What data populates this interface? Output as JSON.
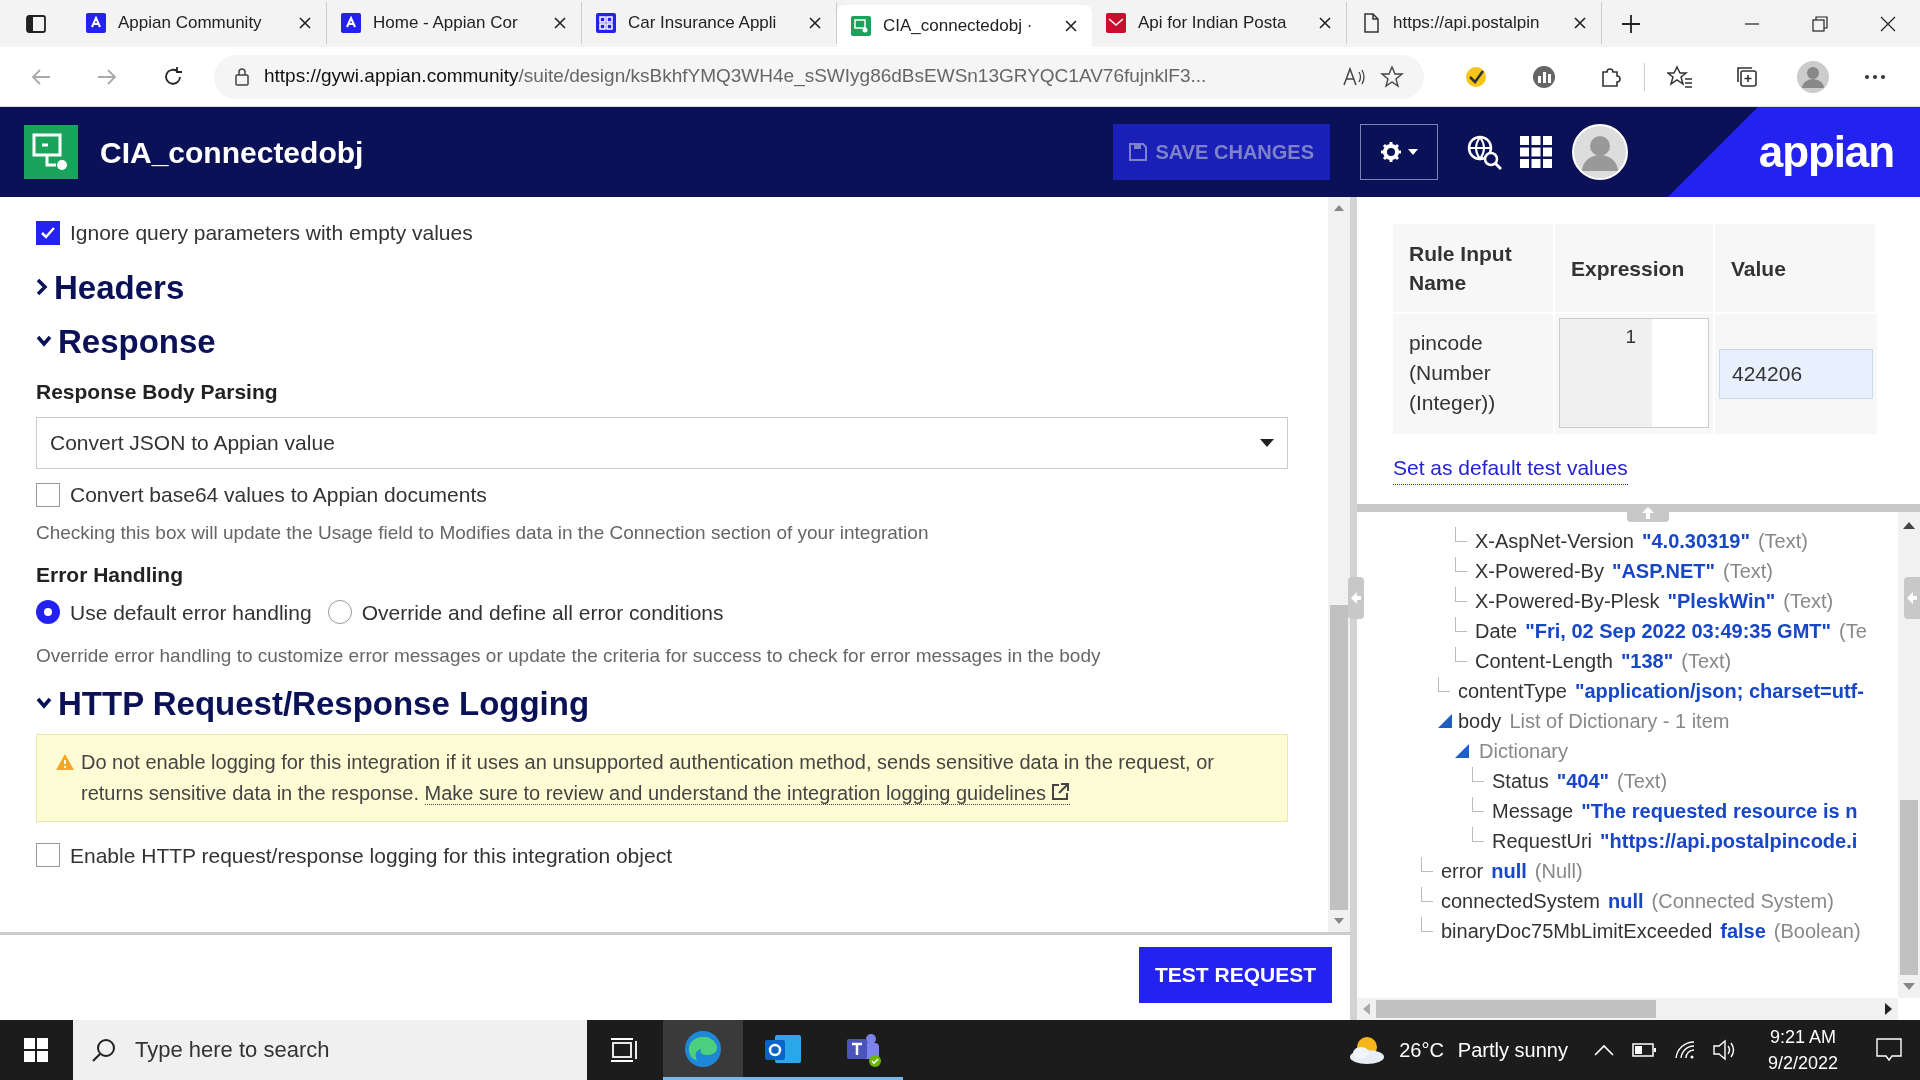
{
  "browser": {
    "tabs": [
      {
        "label": "Appian Community",
        "selected": false
      },
      {
        "label": "Home - Appian Cor",
        "selected": false
      },
      {
        "label": "Car Insurance Appli",
        "selected": false
      },
      {
        "label": "CIA_connectedobj ·",
        "selected": true
      },
      {
        "label": "Api for Indian Posta",
        "selected": false
      },
      {
        "label": "https://api.postalpin",
        "selected": false
      }
    ],
    "url_host": "https://gywi.appian.community",
    "url_path": "/suite/design/ksBkhfYMQ3WH4e_sSWIyg86dBsEWSn13GRYQC1AV76fujnklF3..."
  },
  "header": {
    "title": "CIA_connectedobj",
    "save_button": {
      "label": "SAVE CHANGES",
      "disabled": true
    },
    "brand": "appian"
  },
  "form": {
    "ignore_empty": {
      "label": "Ignore query parameters with empty values",
      "checked": true
    },
    "sections": [
      {
        "title": "Headers",
        "expanded": false
      },
      {
        "title": "Response",
        "expanded": true
      }
    ],
    "parsing_label": "Response Body Parsing",
    "parsing_value": "Convert JSON to Appian value",
    "base64": {
      "label": "Convert base64 values to Appian documents",
      "checked": false
    },
    "base64_help": "Checking this box will update the Usage field to Modifies data in the Connection section of your integration",
    "error_label": "Error Handling",
    "error_options": [
      {
        "label": "Use default error handling",
        "selected": true
      },
      {
        "label": "Override and define all error conditions",
        "selected": false
      }
    ],
    "error_help": "Override error handling to customize error messages or update the criteria for success to check for error messages in the body",
    "logging_section": {
      "title": "HTTP Request/Response Logging",
      "expanded": true
    },
    "warning": "Do not enable logging for this integration if it uses an unsupported authentication method, sends sensitive data in the request, or returns sensitive data in the response.",
    "warning_link": "Make sure to review and understand the integration logging guidelines",
    "logging": {
      "label": "Enable HTTP request/response logging for this integration object",
      "checked": false
    },
    "test_button": "TEST REQUEST"
  },
  "test_inputs": {
    "columns": [
      "Rule Input Name",
      "Expression",
      "Value"
    ],
    "rows": [
      {
        "name": "pincode (Number (Integer))",
        "line_number": "1",
        "value": "424206"
      }
    ],
    "default_link": "Set as default test values"
  },
  "result_tree": [
    {
      "children": [
        {
          "children": [
            {
              "key": "X-AspNet-Version",
              "value": "\"4.0.30319\"",
              "type": "(Text)"
            },
            {
              "key": "X-Powered-By",
              "value": "\"ASP.NET\"",
              "type": "(Text)"
            },
            {
              "key": "X-Powered-By-Plesk",
              "value": "\"PleskWin\"",
              "type": "(Text)"
            },
            {
              "key": "Date",
              "value": "\"Fri, 02 Sep 2022 03:49:35 GMT\"",
              "type": "(Te"
            },
            {
              "key": "Content-Length",
              "value": "\"138\"",
              "type": "(Text)"
            }
          ]
        },
        {
          "key": "contentType",
          "value": "\"application/json; charset=utf-"
        },
        {
          "key": "body",
          "type": "List of Dictionary - 1 item",
          "expanded": true,
          "children": [
            {
              "type": "Dictionary",
              "expanded": true,
              "children": [
                {
                  "key": "Status",
                  "value": "\"404\"",
                  "type": "(Text)"
                },
                {
                  "key": "Message",
                  "value": "\"The requested resource is n"
                },
                {
                  "key": "RequestUri",
                  "value": "\"https://api.postalpincode.i"
                }
              ]
            }
          ]
        }
      ]
    },
    {
      "key": "error",
      "value": "null",
      "type": "(Null)"
    },
    {
      "key": "connectedSystem",
      "value": "null",
      "type": "(Connected System)"
    },
    {
      "key": "binaryDoc75MbLimitExceeded",
      "value": "false",
      "type": "(Boolean)"
    }
  ],
  "taskbar": {
    "search_placeholder": "Type here to search",
    "temperature": "26°C",
    "weather": "Partly sunny",
    "time": "9:21 AM",
    "date": "9/2/2022"
  }
}
